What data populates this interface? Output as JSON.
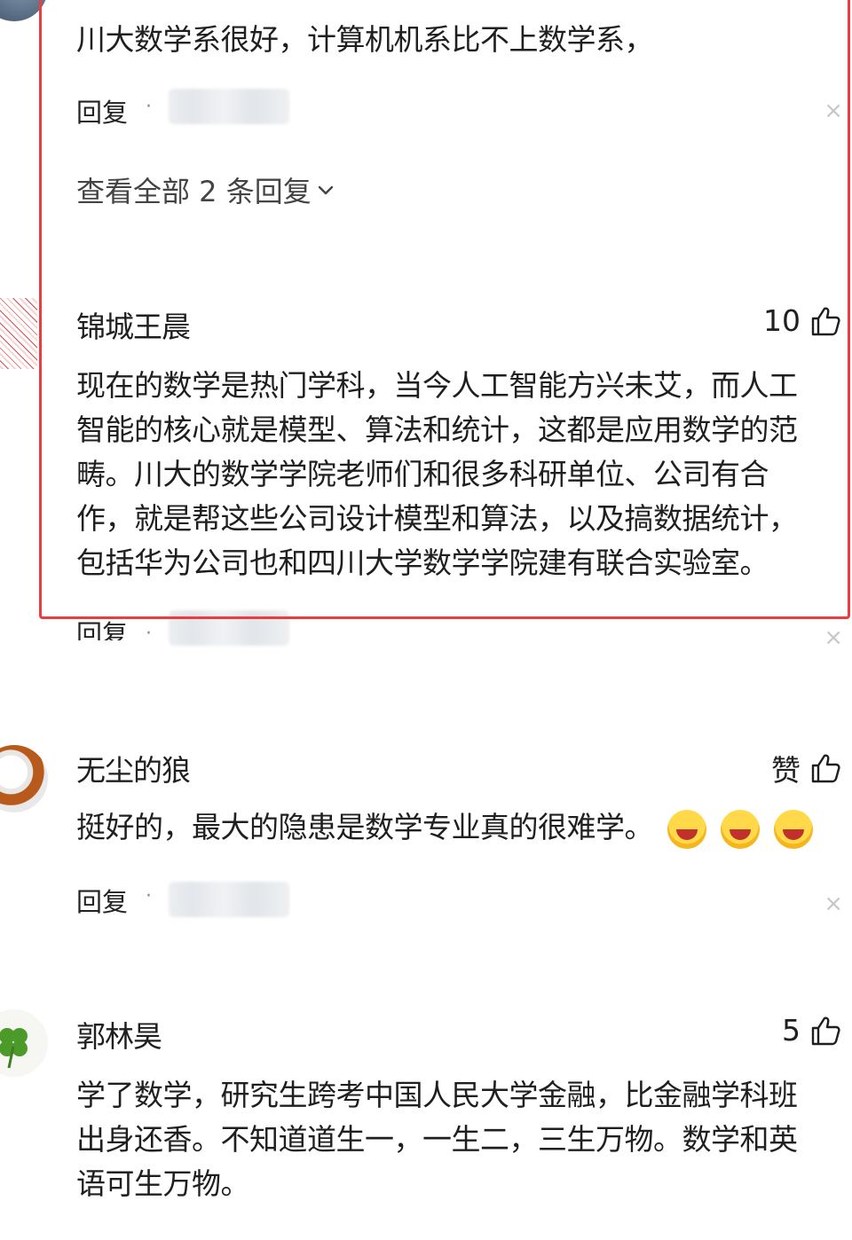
{
  "comments": [
    {
      "text_lines": [
        "川大数学系很好，计算机机系比不上数学系，"
      ],
      "reply_label": "回复",
      "view_all": "查看全部 2 条回复"
    },
    {
      "username": "锦城王晨",
      "likes": "10",
      "text_lines": [
        "现在的数学是热门学科，当今人工智能方兴未艾，而人工",
        "智能的核心就是模型、算法和统计，这都是应用数学的范",
        "畴。川大的数学学院老师们和很多科研单位、公司有合",
        "作，就是帮这些公司设计模型和算法，以及搞数据统计，",
        "包括华为公司也和四川大学数学学院建有联合实验室。"
      ],
      "reply_label": "回复"
    },
    {
      "username": "无尘的狼",
      "likes": "赞",
      "text_lines": [
        "挺好的，最大的隐患是数学专业真的很难学。"
      ],
      "emoji_count": 3,
      "reply_label": "回复"
    },
    {
      "username": "郭林昊",
      "likes": "5",
      "text_lines": [
        "学了数学，研究生跨考中国人民大学金融，比金融学科班",
        "出身还香。不知道道生一，一生二，三生万物。数学和英",
        "语可生万物。"
      ]
    }
  ],
  "icons": {
    "close": "×",
    "like": "thumbs-up-icon",
    "expand": "chevron-down-icon"
  },
  "colors": {
    "highlight_border": "#ee3b3b",
    "text": "#1f1f1f",
    "muted": "#8a8a8a"
  }
}
